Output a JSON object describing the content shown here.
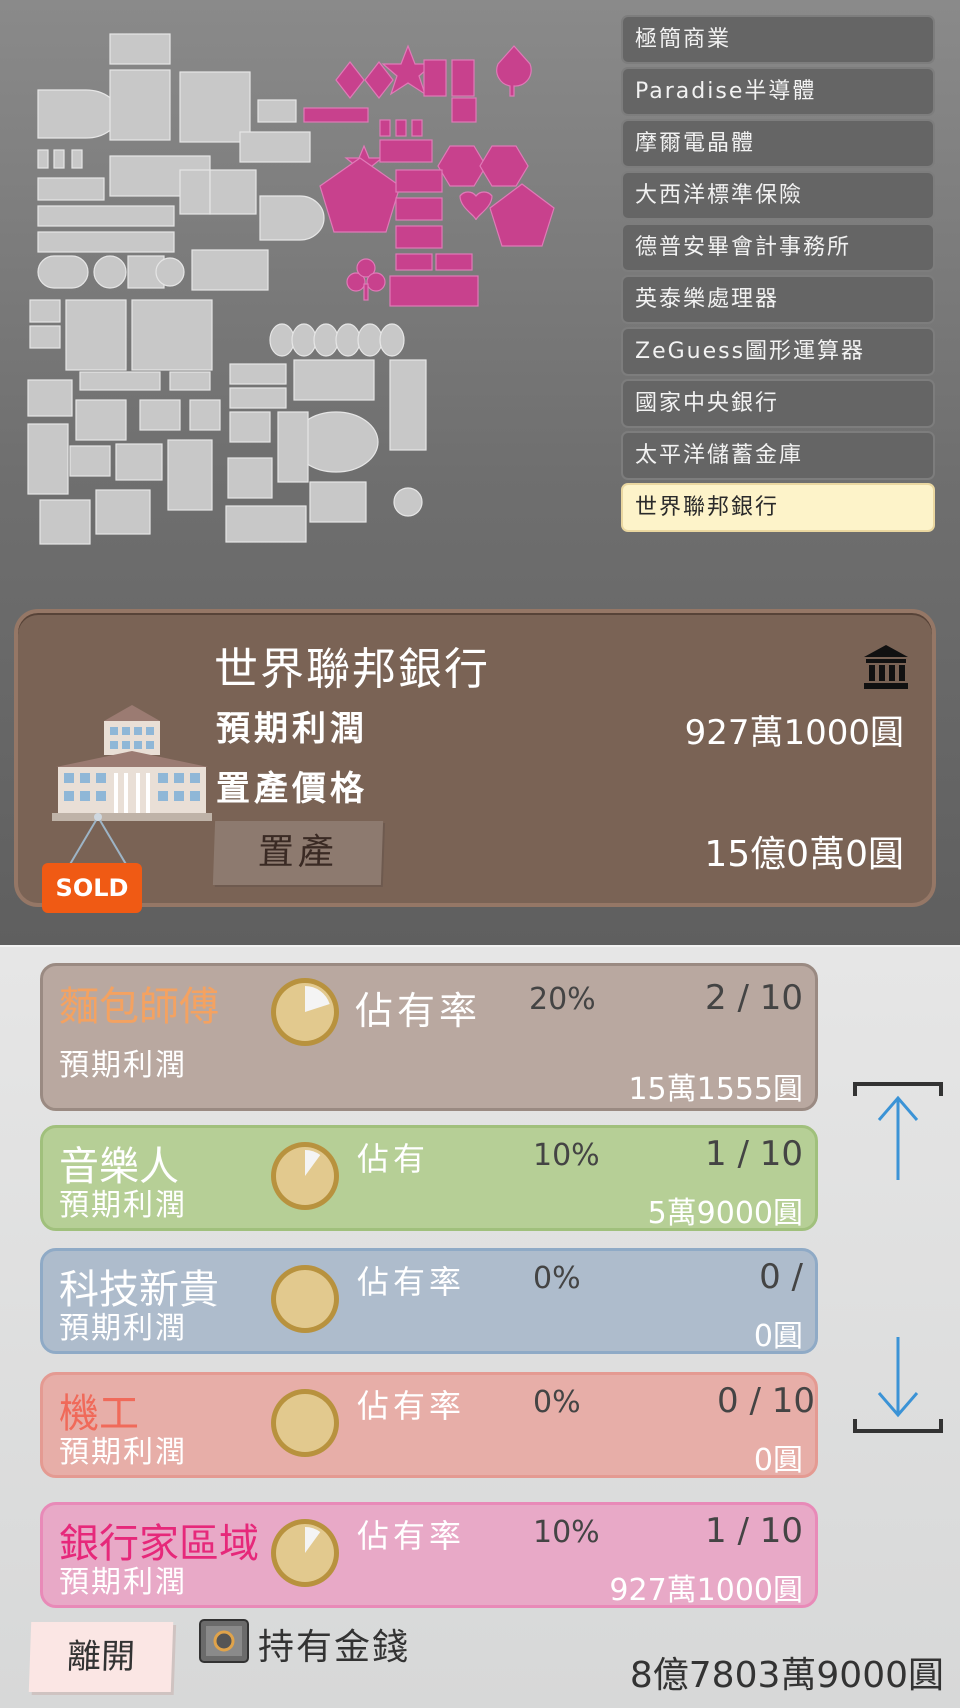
{
  "company_list": [
    {
      "label": "極簡商業"
    },
    {
      "label": "Paradise半導體"
    },
    {
      "label": "摩爾電晶體"
    },
    {
      "label": "大西洋標準保險"
    },
    {
      "label": "德普安畢會計事務所"
    },
    {
      "label": "英泰樂處理器"
    },
    {
      "label": "ZeGuess圖形運算器"
    },
    {
      "label": "國家中央銀行"
    },
    {
      "label": "太平洋儲蓄金庫"
    },
    {
      "label": "世界聯邦銀行"
    }
  ],
  "selected_index": 9,
  "detail": {
    "name": "世界聯邦銀行",
    "profit_label": "預期利潤",
    "profit_value": "927萬1000圓",
    "price_label": "置產價格",
    "price_value": "15億0萬0圓",
    "buy_label": "置產",
    "sold_label": "SOLD",
    "icon": "bank-icon"
  },
  "zones": [
    {
      "name": "麵包師傅",
      "share_label": "佔有率",
      "percent": "20%",
      "count": "2 / 10",
      "profit_label": "預期利潤",
      "profit_value": "15萬1555圓",
      "color": "#f4a261",
      "fill": 0.2
    },
    {
      "name": "音樂人",
      "share_label": "佔有",
      "percent": "10%",
      "count": "1 / 10",
      "profit_label": "預期利潤",
      "profit_value": "5萬9000圓",
      "color": "#c9dba6",
      "fill": 0.1
    },
    {
      "name": "科技新貴",
      "share_label": "佔有率",
      "percent": "0%",
      "count": "0 /",
      "profit_label": "預期利潤",
      "profit_value": "0圓",
      "color": "#a9c1db",
      "fill": 0
    },
    {
      "name": "機工",
      "share_label": "佔有率",
      "percent": "0%",
      "count": "0 / 10",
      "profit_label": "預期利潤",
      "profit_value": "0圓",
      "color": "#f08a80",
      "fill": 0
    },
    {
      "name": "銀行家區域",
      "share_label": "佔有率",
      "percent": "10%",
      "count": "1 / 10",
      "profit_label": "預期利潤",
      "profit_value": "927萬1000圓",
      "color": "#e6287a",
      "fill": 0.1
    }
  ],
  "footer": {
    "leave_label": "離開",
    "money_label": "持有金錢",
    "money_value": "8億7803萬9000圓"
  },
  "icons": {
    "scroll_up": "arrow-up-icon",
    "scroll_down": "arrow-down-icon",
    "safe": "safe-icon"
  }
}
